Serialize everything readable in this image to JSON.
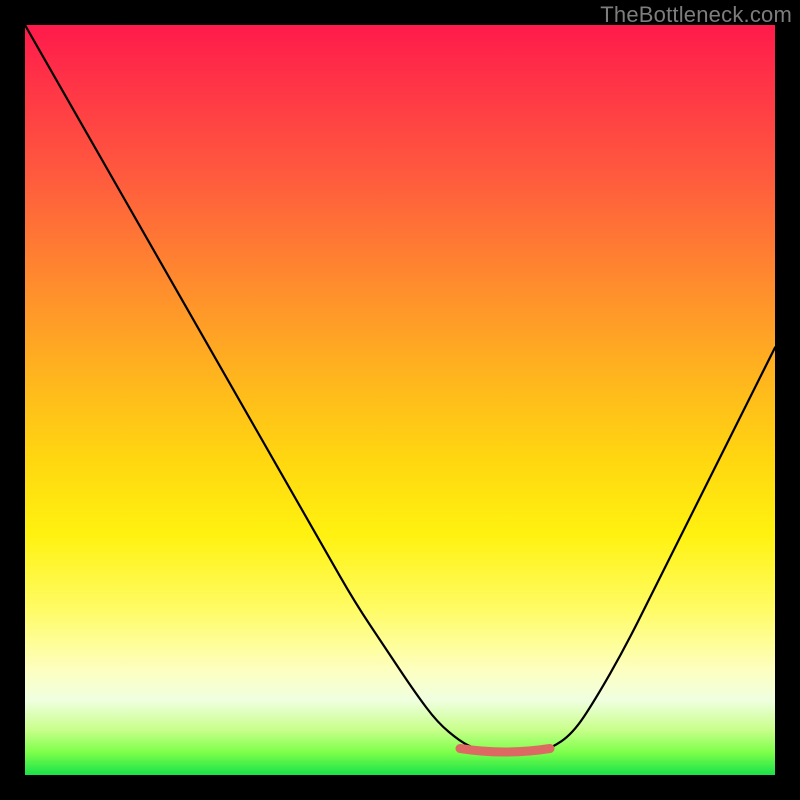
{
  "watermark": "TheBottleneck.com",
  "palette": {
    "frame_bg": "#000000",
    "watermark_color": "#7d7d7d",
    "curve_color": "#000000",
    "min_marker_color": "#dd6a62",
    "gradient_stops": [
      "#ff1a4b",
      "#ff2e48",
      "#ff5a3e",
      "#ff8a2e",
      "#ffb21f",
      "#ffd710",
      "#fff210",
      "#fffc66",
      "#fdffc0",
      "#f0ffe0",
      "#c8ff8a",
      "#7dff4a",
      "#19e24a"
    ]
  },
  "chart_data": {
    "type": "line",
    "title": "",
    "xlabel": "",
    "ylabel": "",
    "xlim": [
      0,
      100
    ],
    "ylim": [
      0,
      100
    ],
    "grid": false,
    "legend": false,
    "note": "x/y are in percent of the inner plot area (0,0 = top-left of gradient box, 100,100 = bottom-right). The curve is a V-shaped bottleneck profile with its minimum plateau near x≈60–70%, y≈97%.",
    "series": [
      {
        "name": "bottleneck-curve",
        "x": [
          0,
          4,
          8,
          12,
          16,
          20,
          24,
          28,
          32,
          36,
          40,
          44,
          48,
          52,
          55,
          58,
          60,
          62,
          65,
          68,
          70,
          73,
          76,
          80,
          84,
          88,
          92,
          96,
          100
        ],
        "y": [
          0,
          7,
          14,
          21,
          28,
          35,
          42,
          49,
          56,
          63,
          70,
          77,
          83,
          89,
          93,
          95.5,
          96.5,
          97,
          97,
          97,
          96.5,
          94.5,
          90,
          83,
          75,
          67,
          59,
          51,
          43
        ]
      }
    ],
    "minimum_plateau": {
      "x_start": 58,
      "x_end": 70,
      "y": 97
    }
  }
}
